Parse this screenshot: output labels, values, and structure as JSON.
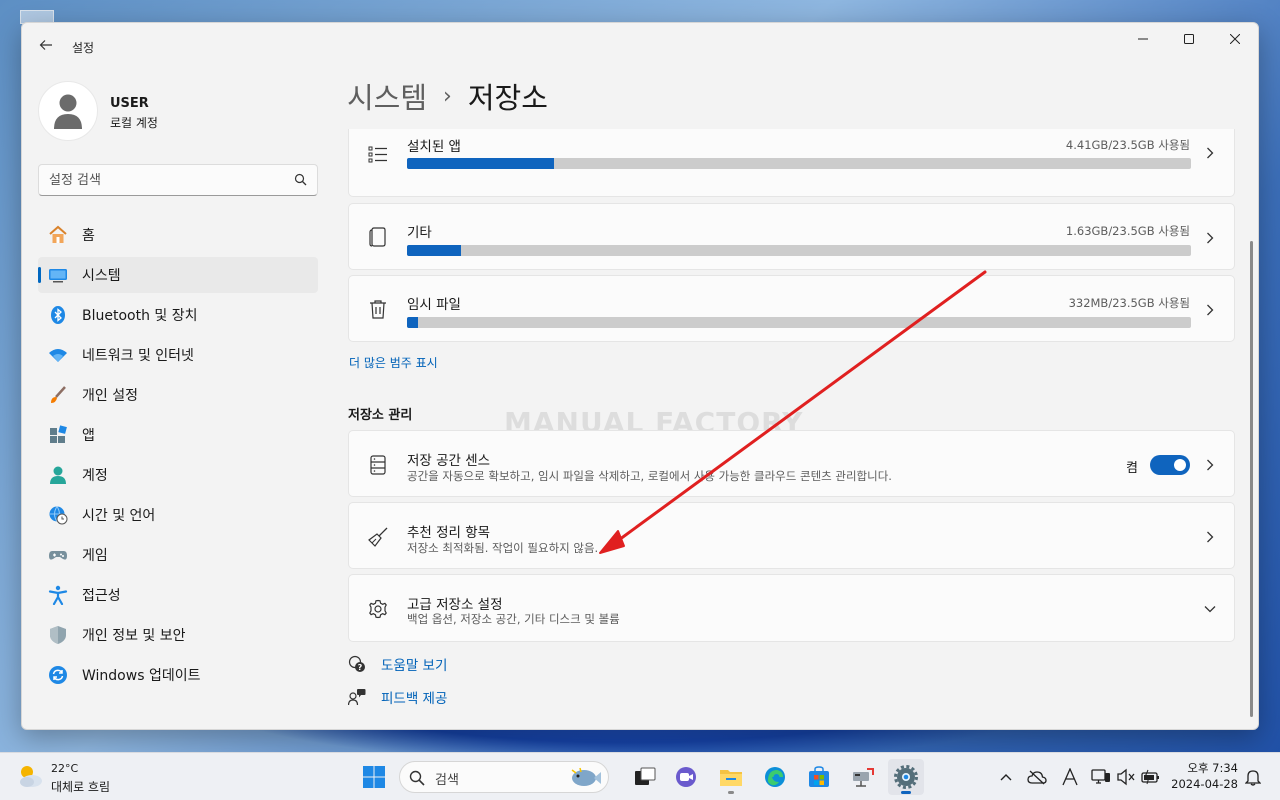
{
  "window": {
    "title": "설정"
  },
  "profile": {
    "name": "USER",
    "account_type": "로컬 계정"
  },
  "search": {
    "placeholder": "설정 검색"
  },
  "nav": {
    "items": [
      {
        "label": "홈",
        "icon": "home-icon"
      },
      {
        "label": "시스템",
        "icon": "system-icon",
        "active": true
      },
      {
        "label": "Bluetooth 및 장치",
        "icon": "bluetooth-icon"
      },
      {
        "label": "네트워크 및 인터넷",
        "icon": "wifi-icon"
      },
      {
        "label": "개인 설정",
        "icon": "brush-icon"
      },
      {
        "label": "앱",
        "icon": "apps-icon"
      },
      {
        "label": "계정",
        "icon": "account-icon"
      },
      {
        "label": "시간 및 언어",
        "icon": "globe-clock-icon"
      },
      {
        "label": "게임",
        "icon": "gamepad-icon"
      },
      {
        "label": "접근성",
        "icon": "accessibility-icon"
      },
      {
        "label": "개인 정보 및 보안",
        "icon": "shield-icon"
      },
      {
        "label": "Windows 업데이트",
        "icon": "update-icon"
      }
    ]
  },
  "breadcrumb": {
    "parent": "시스템",
    "separator": "›",
    "current": "저장소"
  },
  "storage_categories": [
    {
      "title": "설치된 앱",
      "usage": "4.41GB/23.5GB 사용됨",
      "fraction": 0.188,
      "icon": "list-icon"
    },
    {
      "title": "기타",
      "usage": "1.63GB/23.5GB 사용됨",
      "fraction": 0.069,
      "icon": "document-icon"
    },
    {
      "title": "임시 파일",
      "usage": "332MB/23.5GB 사용됨",
      "fraction": 0.014,
      "icon": "trash-icon"
    }
  ],
  "more_categories_link": "더 많은 범주 표시",
  "management": {
    "title": "저장소 관리",
    "storage_sense": {
      "title": "저장 공간 센스",
      "subtitle": "공간을 자동으로 확보하고, 임시 파일을 삭제하고, 로컬에서 사용 가능한 클라우드 콘텐츠 관리합니다.",
      "toggle_label": "켬",
      "toggle_on": true
    },
    "cleanup": {
      "title": "추천 정리 항목",
      "subtitle": "저장소 최적화됨. 작업이 필요하지 않음."
    },
    "advanced": {
      "title": "고급 저장소 설정",
      "subtitle": "백업 옵션, 저장소 공간, 기타 디스크 및 볼륨"
    }
  },
  "watermark": "MANUAL FACTORY",
  "help": {
    "get_help": "도움말 보기",
    "feedback": "피드백 제공"
  },
  "taskbar": {
    "weather": {
      "temp": "22°C",
      "desc": "대체로 흐림"
    },
    "search_placeholder": "검색",
    "clock": {
      "time": "오후 7:34",
      "date": "2024-04-28"
    }
  },
  "colors": {
    "accent": "#0f64be",
    "annotation_arrow": "#e02020"
  }
}
